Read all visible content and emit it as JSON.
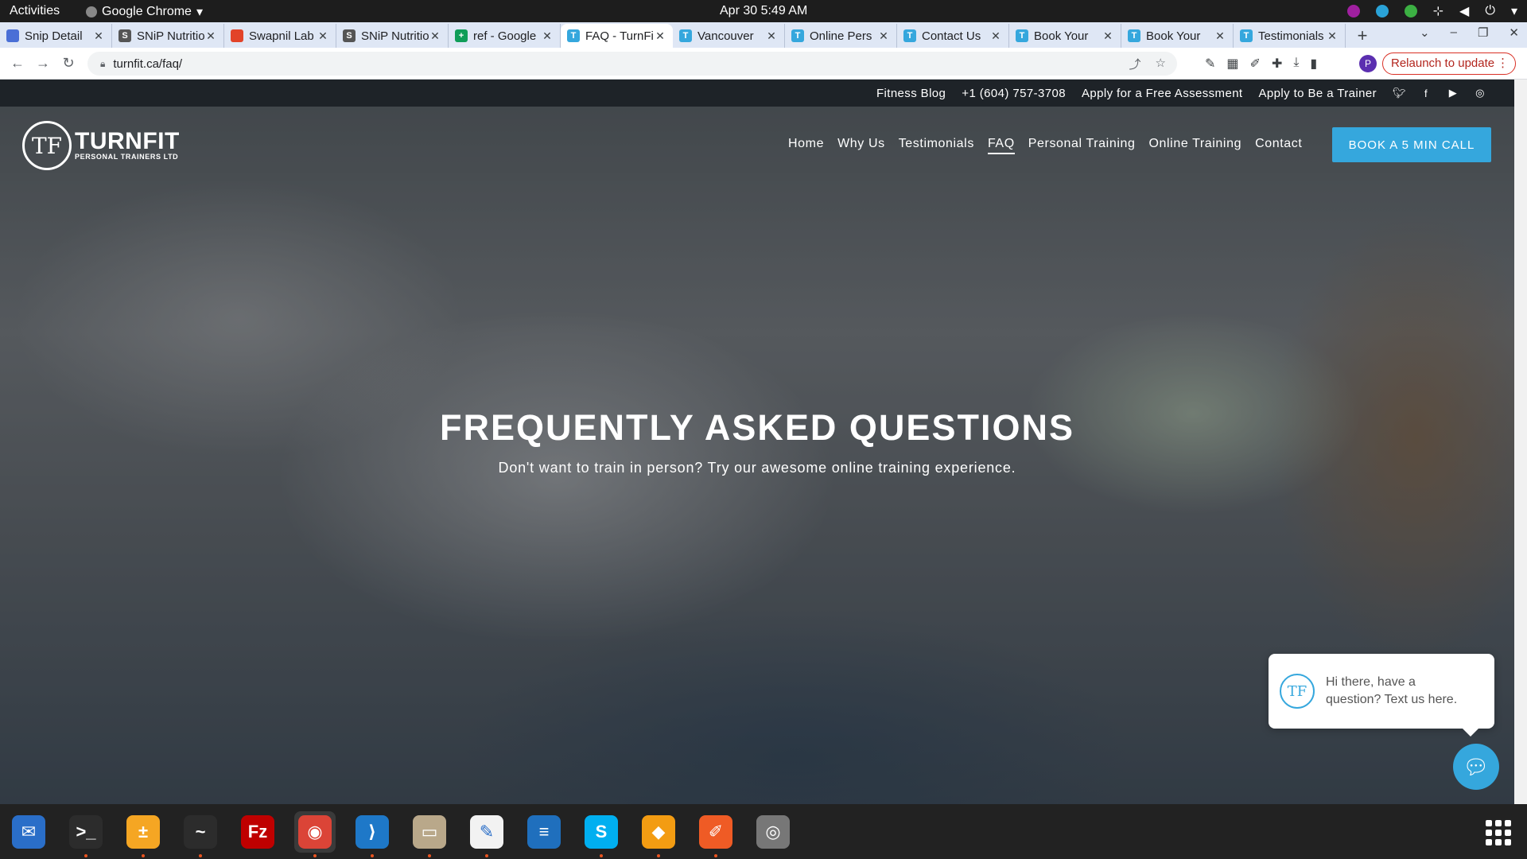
{
  "system": {
    "activities": "Activities",
    "app_menu": "Google Chrome",
    "clock": "Apr 30  5:49 AM"
  },
  "tabs": [
    {
      "title": "Snip Detail",
      "fav_color": "#4a6fd6",
      "fav_glyph": ""
    },
    {
      "title": "SNiP Nutrition",
      "fav_color": "#555555",
      "fav_glyph": "S"
    },
    {
      "title": "Swapnil Lab",
      "fav_color": "#e24329",
      "fav_glyph": ""
    },
    {
      "title": "SNiP Nutrition",
      "fav_color": "#555555",
      "fav_glyph": "S"
    },
    {
      "title": "ref - Google",
      "fav_color": "#0f9d58",
      "fav_glyph": "+"
    },
    {
      "title": "FAQ - TurnFit",
      "fav_color": "#35a7dd",
      "fav_glyph": "T",
      "active": true
    },
    {
      "title": "Vancouver",
      "fav_color": "#35a7dd",
      "fav_glyph": "T"
    },
    {
      "title": "Online Pers",
      "fav_color": "#35a7dd",
      "fav_glyph": "T"
    },
    {
      "title": "Contact Us",
      "fav_color": "#35a7dd",
      "fav_glyph": "T"
    },
    {
      "title": "Book Your",
      "fav_color": "#35a7dd",
      "fav_glyph": "T"
    },
    {
      "title": "Book Your",
      "fav_color": "#35a7dd",
      "fav_glyph": "T"
    },
    {
      "title": "Testimonials",
      "fav_color": "#35a7dd",
      "fav_glyph": "T"
    }
  ],
  "browser": {
    "url": "turnfit.ca/faq/",
    "profile_initial": "P",
    "relaunch_label": "Relaunch to update"
  },
  "utility_bar": {
    "links": [
      "Fitness Blog",
      "+1 (604) 757-3708",
      "Apply for a Free Assessment",
      "Apply to Be a Trainer"
    ],
    "social_icons": [
      "twitter-icon",
      "facebook-icon",
      "youtube-icon",
      "instagram-icon"
    ]
  },
  "logo": {
    "mark": "TF",
    "brand": "TURNFIT",
    "tagline": "PERSONAL TRAINERS LTD"
  },
  "nav": {
    "items": [
      "Home",
      "Why Us",
      "Testimonials",
      "FAQ",
      "Personal Training",
      "Online Training",
      "Contact"
    ],
    "active_index": 3,
    "cta_label": "BOOK A 5 MIN CALL"
  },
  "hero": {
    "title": "FREQUENTLY ASKED QUESTIONS",
    "subtitle": "Don't want to train in person? Try our awesome online training experience."
  },
  "chat": {
    "mark": "TF",
    "message": "Hi there, have a question? Text us here."
  },
  "colors": {
    "accent": "#35a7dd",
    "utility_bar": "#1e2328",
    "relaunch": "#d93025"
  },
  "dock": [
    {
      "name": "thunderbird-icon",
      "color": "#2a6ec8",
      "glyph": "✉"
    },
    {
      "name": "terminal-icon",
      "color": "#2c2c2c",
      "glyph": ">_",
      "running": true
    },
    {
      "name": "calculator-icon",
      "color": "#f5a623",
      "glyph": "±",
      "running": true
    },
    {
      "name": "system-monitor-icon",
      "color": "#2c2c2c",
      "glyph": "~",
      "running": true
    },
    {
      "name": "filezilla-icon",
      "color": "#bf0000",
      "glyph": "Fz"
    },
    {
      "name": "chrome-icon",
      "color": "#db4437",
      "glyph": "◉",
      "running": true,
      "active": true
    },
    {
      "name": "vscode-icon",
      "color": "#1e78c8",
      "glyph": "⟩",
      "running": true
    },
    {
      "name": "files-icon",
      "color": "#b9a88a",
      "glyph": "▭",
      "running": true
    },
    {
      "name": "text-editor-icon",
      "color": "#f2f2f2",
      "glyph": "✎",
      "running": true
    },
    {
      "name": "libreoffice-writer-icon",
      "color": "#1f6fbd",
      "glyph": "≡"
    },
    {
      "name": "skype-icon",
      "color": "#00aff0",
      "glyph": "S",
      "running": true
    },
    {
      "name": "hotspot-icon",
      "color": "#f39c12",
      "glyph": "◆",
      "running": true
    },
    {
      "name": "postman-icon",
      "color": "#ef5b25",
      "glyph": "✐",
      "running": true
    },
    {
      "name": "disk-icon",
      "color": "#777777",
      "glyph": "◎"
    }
  ]
}
